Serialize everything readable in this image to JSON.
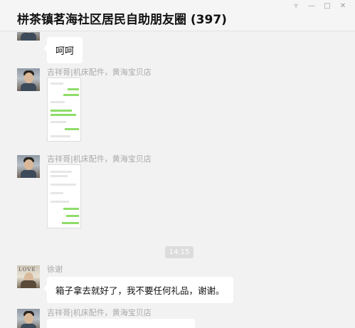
{
  "window": {
    "title": "栟茶镇茗海社区居民自助朋友圈 (397)",
    "controls": [
      "pin-icon",
      "minimize-icon",
      "maximize-icon",
      "close-icon"
    ]
  },
  "messages": [
    {
      "type": "text",
      "sender": "",
      "text": "呵呵"
    },
    {
      "type": "image",
      "sender": "吉祥哥|机床配件，黄海宝贝店"
    },
    {
      "type": "image",
      "sender": "吉祥哥|机床配件，黄海宝贝店"
    },
    {
      "type": "time",
      "text": "14:15"
    },
    {
      "type": "text",
      "sender": "徐谢",
      "text": "箱子拿去就好了，我不要任何礼品，谢谢。"
    },
    {
      "type": "partial",
      "sender": "吉祥哥|机床配件，黄海宝贝店"
    }
  ],
  "colors": {
    "background": "#f2f2f2",
    "bubble": "#ffffff",
    "green_bubble": "#8fdc6a"
  }
}
